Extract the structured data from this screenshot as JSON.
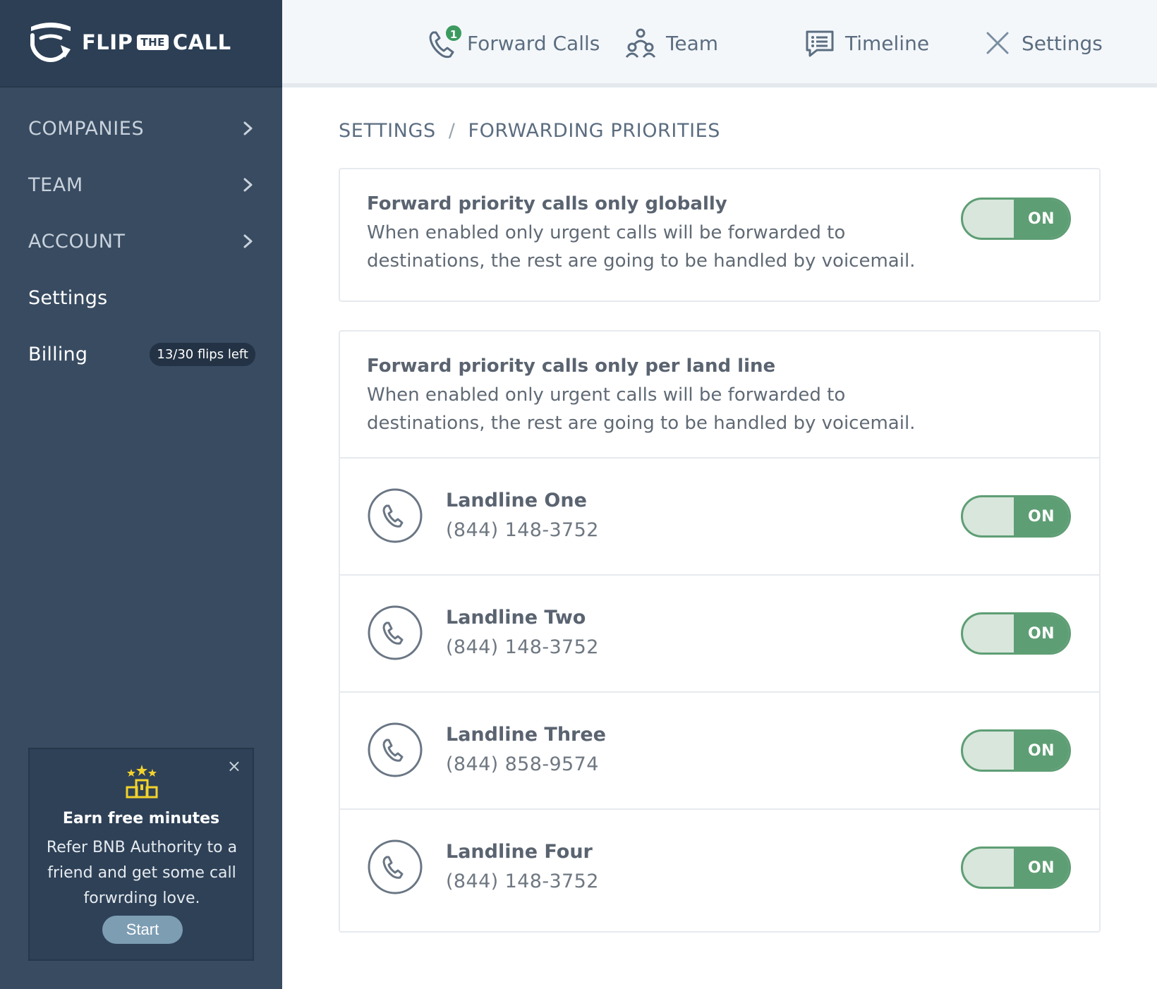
{
  "brand": {
    "flip": "FLIP",
    "the": "THE",
    "call": "CALL"
  },
  "sidebar": {
    "items": [
      {
        "label": "COMPANIES"
      },
      {
        "label": "TEAM"
      },
      {
        "label": "ACCOUNT"
      },
      {
        "label": "Settings"
      },
      {
        "label": "Billing",
        "badge": "13/30 flips left"
      }
    ],
    "promo": {
      "close": "×",
      "title": "Earn free minutes",
      "body": "Refer BNB Authority to a friend and get some call forwrding love.",
      "button": "Start"
    }
  },
  "topnav": {
    "forward_calls": {
      "label": "Forward Calls",
      "badge": "1"
    },
    "team": {
      "label": "Team"
    },
    "timeline": {
      "label": "Timeline"
    },
    "settings": {
      "label": "Settings"
    }
  },
  "breadcrumb": {
    "root": "SETTINGS",
    "separator": "/",
    "current": "FORWARDING PRIORITIES"
  },
  "global_setting": {
    "title": "Forward priority calls only globally",
    "description": "When enabled only urgent calls will be forwarded to destinations, the rest are going to be handled by voicemail.",
    "toggle": "ON"
  },
  "per_line_setting": {
    "title": "Forward priority calls only per land line",
    "description": "When enabled only urgent calls will be forwarded to destinations, the rest are going to be handled by voicemail."
  },
  "landlines": [
    {
      "name": "Landline One",
      "number": "(844) 148-3752",
      "toggle": "ON"
    },
    {
      "name": "Landline Two",
      "number": "(844) 148-3752",
      "toggle": "ON"
    },
    {
      "name": "Landline Three",
      "number": "(844) 858-9574",
      "toggle": "ON"
    },
    {
      "name": "Landline Four",
      "number": "(844) 148-3752",
      "toggle": "ON"
    }
  ],
  "colors": {
    "sidebar_bg": "#384b61",
    "brand_bg": "#2c3f55",
    "toggle_on": "#5e9e74",
    "toggle_off_track": "#d8e6dc",
    "badge_green": "#3c9a5f",
    "trophy_yellow": "#f3d22b",
    "start_button": "#7d9db3"
  },
  "icons": {
    "logo": "flip-arrow-logo",
    "nav_chevron": "chevron-right-icon",
    "forward_calls": "phone-forward-icon",
    "team": "team-icon",
    "timeline": "chat-list-icon",
    "settings": "x-settings-icon",
    "trophy": "trophy-stars-icon",
    "landline": "phone-icon"
  }
}
